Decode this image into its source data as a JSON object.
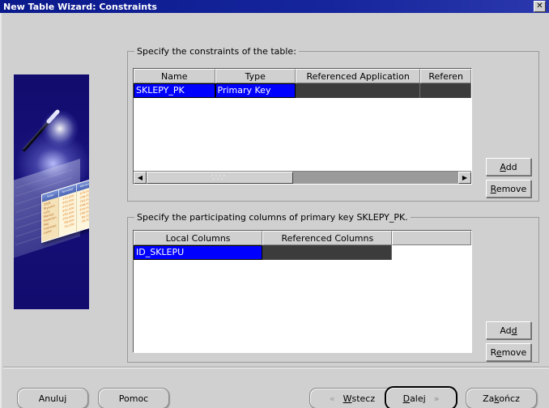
{
  "window": {
    "title": "New Table Wizard: Constraints",
    "close_label": "✕"
  },
  "side_panel": {
    "icon": "wizard-wand-graphic",
    "sheet_headers": [
      "Sklep",
      "Sprzedaz",
      "Wartosc"
    ],
    "sheet_col1": [
      "2001",
      "Styczen",
      "Luty",
      "Marzec",
      "Kwiecien",
      "Maj",
      "Czerwiec",
      "Lipiec",
      "Razem"
    ],
    "sheet_col2": [
      "120,000",
      "345,000",
      "210,000",
      "432,000",
      "190,000",
      "150,000",
      "98,000",
      "16,200"
    ],
    "sheet_col3": [
      "475,000",
      "246,000",
      "763,000",
      "648,000",
      "616,000",
      "190,000",
      "84,200",
      "18,300"
    ]
  },
  "constraints_group": {
    "title": "Specify the constraints of the table:",
    "columns": [
      "Name",
      "Type",
      "Referenced Application",
      "Referen"
    ],
    "rows": [
      {
        "name": "SKLEPY_PK",
        "type": "Primary Key",
        "referenced_application": "",
        "referenced": ""
      }
    ],
    "scrollbar": {
      "left_arrow": "◀",
      "right_arrow": "▶"
    },
    "add_label_pre": "A",
    "add_label_mn": "A",
    "buttons": {
      "add": {
        "before": "",
        "mnemonic": "A",
        "after": "dd"
      },
      "remove": {
        "before": "",
        "mnemonic": "R",
        "after": "emove"
      }
    }
  },
  "columns_group": {
    "title": "Specify the participating columns of primary key SKLEPY_PK.",
    "columns": [
      "Local Columns",
      "Referenced Columns",
      ""
    ],
    "rows": [
      {
        "local_column": "ID_SKLEPU",
        "referenced_column": "",
        "extra": ""
      }
    ],
    "buttons": {
      "add": {
        "before": "Ad",
        "mnemonic": "d",
        "after": ""
      },
      "remove": {
        "before": "R",
        "mnemonic": "e",
        "after": "move"
      }
    }
  },
  "footer": {
    "cancel": {
      "before": "",
      "mnemonic": "",
      "after": "Anuluj"
    },
    "help": {
      "before": "",
      "mnemonic": "",
      "after": "Pomoc"
    },
    "back": {
      "before": "",
      "mnemonic": "W",
      "after": "stecz",
      "icon": "«"
    },
    "next": {
      "before": "",
      "mnemonic": "D",
      "after": "alej",
      "icon": "»"
    },
    "finish": {
      "before": "Za",
      "mnemonic": "k",
      "after": "ończ"
    }
  },
  "colors": {
    "titlebar": "#16259c",
    "selection": "#0000ff",
    "dialog_bg": "#d0d0d0",
    "dark_cell": "#3c3c3c",
    "panel_blue": "#120c6e"
  }
}
